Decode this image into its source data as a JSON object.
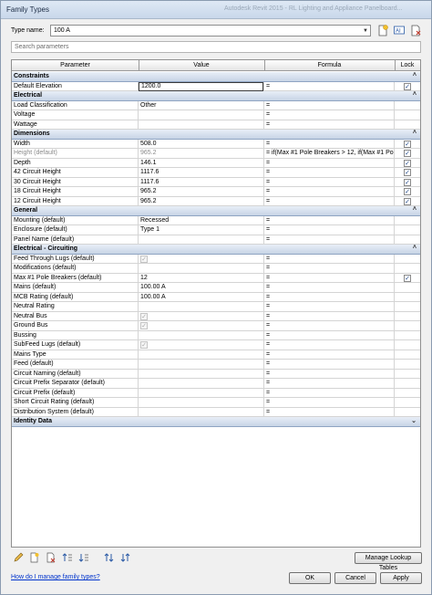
{
  "window": {
    "title": "Family Types",
    "background_title": "Autodesk Revit 2015 - RL Lighting and Appliance Panelboard..."
  },
  "type_name": {
    "label": "Type name:",
    "value": "100 A"
  },
  "search": {
    "placeholder": "Search parameters"
  },
  "columns": [
    "Parameter",
    "Value",
    "Formula",
    "Lock"
  ],
  "groups": [
    {
      "name": "Constraints",
      "rows": [
        {
          "param": "Default Elevation",
          "value": "1200.0",
          "formula": "=",
          "lock": "checked",
          "editing": true
        }
      ]
    },
    {
      "name": "Electrical",
      "rows": [
        {
          "param": "Load Classification",
          "value": "Other",
          "formula": "=",
          "lock": "none"
        },
        {
          "param": "Voltage",
          "value": "",
          "formula": "=",
          "lock": "none"
        },
        {
          "param": "Wattage",
          "value": "",
          "formula": "=",
          "lock": "none"
        }
      ]
    },
    {
      "name": "Dimensions",
      "rows": [
        {
          "param": "Width",
          "value": "508.0",
          "formula": "=",
          "lock": "checked"
        },
        {
          "param": "Height (default)",
          "value": "965.2",
          "formula": "= if(Max #1 Pole Breakers > 12, if(Max #1 Pol",
          "lock": "checked",
          "gray": true
        },
        {
          "param": "Depth",
          "value": "146.1",
          "formula": "=",
          "lock": "checked"
        },
        {
          "param": "42 Circuit Height",
          "value": "1117.6",
          "formula": "=",
          "lock": "checked"
        },
        {
          "param": "30 Circuit Height",
          "value": "1117.6",
          "formula": "=",
          "lock": "checked"
        },
        {
          "param": "18 Circuit Height",
          "value": "965.2",
          "formula": "=",
          "lock": "checked"
        },
        {
          "param": "12 Circuit Height",
          "value": "965.2",
          "formula": "=",
          "lock": "checked"
        }
      ]
    },
    {
      "name": "General",
      "rows": [
        {
          "param": "Mounting (default)",
          "value": "Recessed",
          "formula": "=",
          "lock": "none"
        },
        {
          "param": "Enclosure (default)",
          "value": "Type 1",
          "formula": "=",
          "lock": "none"
        },
        {
          "param": "Panel Name (default)",
          "value": "",
          "formula": "=",
          "lock": "none"
        }
      ]
    },
    {
      "name": "Electrical - Circuiting",
      "rows": [
        {
          "param": "Feed Through Lugs (default)",
          "value": "",
          "value_check": "disabled",
          "formula": "=",
          "lock": "none"
        },
        {
          "param": "Modifications (default)",
          "value": "",
          "formula": "=",
          "lock": "none"
        },
        {
          "param": "Max #1 Pole Breakers (default)",
          "value": "12",
          "formula": "=",
          "lock": "checked"
        },
        {
          "param": "Mains (default)",
          "value": "100.00 A",
          "formula": "=",
          "lock": "none"
        },
        {
          "param": "MCB Rating (default)",
          "value": "100.00 A",
          "formula": "=",
          "lock": "none"
        },
        {
          "param": "Neutral Rating",
          "value": "",
          "formula": "=",
          "lock": "none"
        },
        {
          "param": "Neutral Bus",
          "value": "",
          "value_check": "disabled",
          "formula": "=",
          "lock": "none"
        },
        {
          "param": "Ground Bus",
          "value": "",
          "value_check": "disabled",
          "formula": "=",
          "lock": "none"
        },
        {
          "param": "Bussing",
          "value": "",
          "formula": "=",
          "lock": "none"
        },
        {
          "param": "SubFeed Lugs (default)",
          "value": "",
          "value_check": "disabled",
          "formula": "=",
          "lock": "none"
        },
        {
          "param": "Mains Type",
          "value": "",
          "formula": "=",
          "lock": "none"
        },
        {
          "param": "Feed (default)",
          "value": "",
          "formula": "=",
          "lock": "none"
        },
        {
          "param": "Circuit Naming (default)",
          "value": "",
          "formula": "=",
          "lock": "none"
        },
        {
          "param": "Circuit Prefix Separator (default)",
          "value": "",
          "formula": "=",
          "lock": "none"
        },
        {
          "param": "Circuit Prefix (default)",
          "value": "",
          "formula": "=",
          "lock": "none"
        },
        {
          "param": "Short Circuit Rating (default)",
          "value": "",
          "formula": "=",
          "lock": "none"
        },
        {
          "param": "Distribution System (default)",
          "value": "",
          "formula": "=",
          "lock": "none"
        }
      ]
    },
    {
      "name": "Identity Data",
      "collapsed": true,
      "rows": []
    }
  ],
  "buttons": {
    "manage_lookup": "Manage Lookup Tables",
    "ok": "OK",
    "cancel": "Cancel",
    "apply": "Apply"
  },
  "help_link": "How do I manage family types?",
  "icons": {
    "toolbar": [
      "new-type-icon",
      "rename-type-icon",
      "delete-type-icon"
    ],
    "bottom": [
      "edit-parameter-icon",
      "new-parameter-icon",
      "remove-parameter-icon",
      "move-up-icon",
      "move-down-icon",
      "sort-ascending-icon",
      "sort-descending-icon"
    ]
  },
  "colors": {
    "group_header": "#c7d4e6",
    "link": "#0033cc",
    "check": "#244a8a"
  }
}
